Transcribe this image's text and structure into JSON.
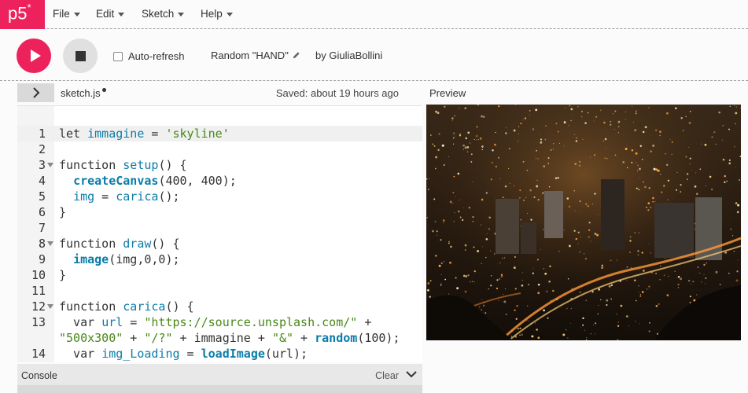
{
  "app": {
    "logo_text": "p5",
    "logo_sup": "*",
    "brand_color": "#ed225d"
  },
  "menu": [
    {
      "label": "File"
    },
    {
      "label": "Edit"
    },
    {
      "label": "Sketch"
    },
    {
      "label": "Help"
    }
  ],
  "toolbar": {
    "autorefresh_label": "Auto-refresh",
    "autorefresh_checked": false,
    "project_name": "Random \"HAND\"",
    "byline": "by GiuliaBollini"
  },
  "editor": {
    "filename": "sketch.js",
    "unsaved_dot": true,
    "saved_status": "Saved: about 19 hours ago",
    "lines": [
      {
        "n": "1",
        "active": true,
        "fold": false,
        "tokens": [
          [
            "kw",
            "let "
          ],
          [
            "fn",
            "immagine"
          ],
          [
            "plain",
            " = "
          ],
          [
            "str",
            "'skyline'"
          ]
        ]
      },
      {
        "n": "2",
        "fold": false,
        "tokens": []
      },
      {
        "n": "3",
        "fold": true,
        "tokens": [
          [
            "kw",
            "function "
          ],
          [
            "fn",
            "setup"
          ],
          [
            "plain",
            "() {"
          ]
        ]
      },
      {
        "n": "4",
        "fold": false,
        "tokens": [
          [
            "plain",
            "  "
          ],
          [
            "fnb",
            "createCanvas"
          ],
          [
            "plain",
            "(400, 400);"
          ]
        ]
      },
      {
        "n": "5",
        "fold": false,
        "tokens": [
          [
            "plain",
            "  "
          ],
          [
            "fn",
            "img"
          ],
          [
            "plain",
            " = "
          ],
          [
            "fn",
            "carica"
          ],
          [
            "plain",
            "();"
          ]
        ]
      },
      {
        "n": "6",
        "fold": false,
        "tokens": [
          [
            "plain",
            "}"
          ]
        ]
      },
      {
        "n": "7",
        "fold": false,
        "tokens": []
      },
      {
        "n": "8",
        "fold": true,
        "tokens": [
          [
            "kw",
            "function "
          ],
          [
            "fn",
            "draw"
          ],
          [
            "plain",
            "() {"
          ]
        ]
      },
      {
        "n": "9",
        "fold": false,
        "tokens": [
          [
            "plain",
            "  "
          ],
          [
            "fnb",
            "image"
          ],
          [
            "plain",
            "(img,0,0);"
          ]
        ]
      },
      {
        "n": "10",
        "fold": false,
        "tokens": [
          [
            "plain",
            "}"
          ]
        ]
      },
      {
        "n": "11",
        "fold": false,
        "tokens": []
      },
      {
        "n": "12",
        "fold": true,
        "tokens": [
          [
            "kw",
            "function "
          ],
          [
            "fn",
            "carica"
          ],
          [
            "plain",
            "() {"
          ]
        ]
      },
      {
        "n": "13",
        "fold": false,
        "tokens": [
          [
            "plain",
            "  var "
          ],
          [
            "fn",
            "url"
          ],
          [
            "plain",
            " = "
          ],
          [
            "str",
            "\"https://source.unsplash.com/\""
          ],
          [
            "plain",
            " +"
          ]
        ]
      },
      {
        "n": "",
        "fold": false,
        "tokens": [
          [
            "str",
            "\"500x300\""
          ],
          [
            "plain",
            " + "
          ],
          [
            "str",
            "\"/?\""
          ],
          [
            "plain",
            " + immagine + "
          ],
          [
            "str",
            "\"&\""
          ],
          [
            "plain",
            " + "
          ],
          [
            "fnb",
            "random"
          ],
          [
            "plain",
            "(100);"
          ]
        ]
      },
      {
        "n": "14",
        "fold": false,
        "tokens": [
          [
            "plain",
            "  var "
          ],
          [
            "fn",
            "img_Loading"
          ],
          [
            "plain",
            " = "
          ],
          [
            "fnb",
            "loadImage"
          ],
          [
            "plain",
            "(url);"
          ]
        ]
      }
    ]
  },
  "preview": {
    "label": "Preview",
    "image_desc": "skyline"
  },
  "console": {
    "title": "Console",
    "clear_label": "Clear"
  }
}
